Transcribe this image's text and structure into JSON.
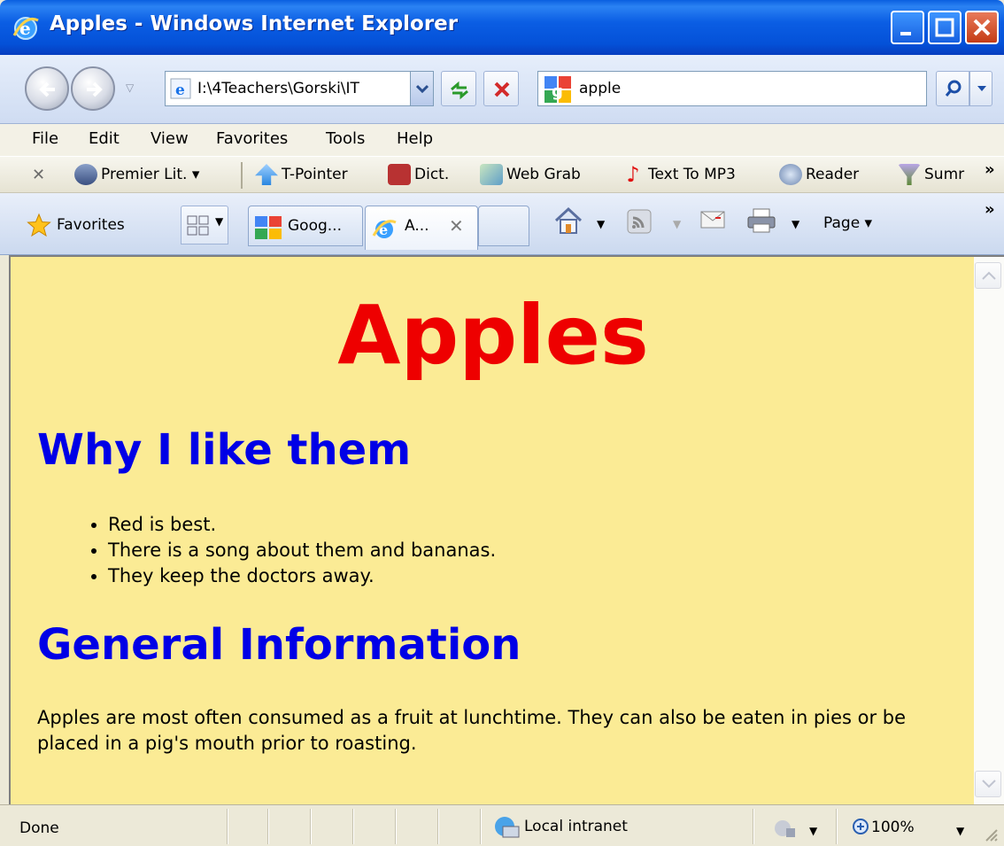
{
  "window": {
    "title": "Apples - Windows Internet Explorer"
  },
  "address_bar": {
    "url": "I:\\4Teachers\\Gorski\\IT"
  },
  "search": {
    "query": "apple"
  },
  "menu": {
    "items": [
      "File",
      "Edit",
      "View",
      "Favorites",
      "Tools",
      "Help"
    ]
  },
  "links_toolbar": {
    "items": [
      {
        "label": "Premier Lit. ▾",
        "icon": "premier-icon"
      },
      {
        "label": "T-Pointer",
        "icon": "pointer-icon"
      },
      {
        "label": "Dict.",
        "icon": "dictionary-icon"
      },
      {
        "label": "Web Grab",
        "icon": "webgrab-icon"
      },
      {
        "label": "Text To MP3",
        "icon": "music-icon"
      },
      {
        "label": "Reader",
        "icon": "reader-icon"
      },
      {
        "label": "Sumr",
        "icon": "summarizer-icon"
      }
    ]
  },
  "command_bar": {
    "favorites_label": "Favorites",
    "tabs": [
      {
        "label": "Goog...",
        "icon": "google-icon"
      },
      {
        "label": "A...",
        "icon": "ie-icon"
      }
    ],
    "page_label": "Page ▾"
  },
  "page": {
    "heading": "Apples",
    "section1_heading": "Why I like them",
    "reasons": [
      "Red is best.",
      "There is a song about them and bananas.",
      "They keep the doctors away."
    ],
    "section2_heading": "General Information",
    "paragraph": "Apples are most often consumed as a fruit at lunchtime. They can also be eaten in pies or be placed in a pig's mouth prior to roasting.",
    "background_color": "#fbeb95",
    "heading_color": "#ee0000",
    "subheading_color": "#0000e6"
  },
  "status_bar": {
    "status": "Done",
    "zone": "Local intranet",
    "zoom": "100%"
  }
}
